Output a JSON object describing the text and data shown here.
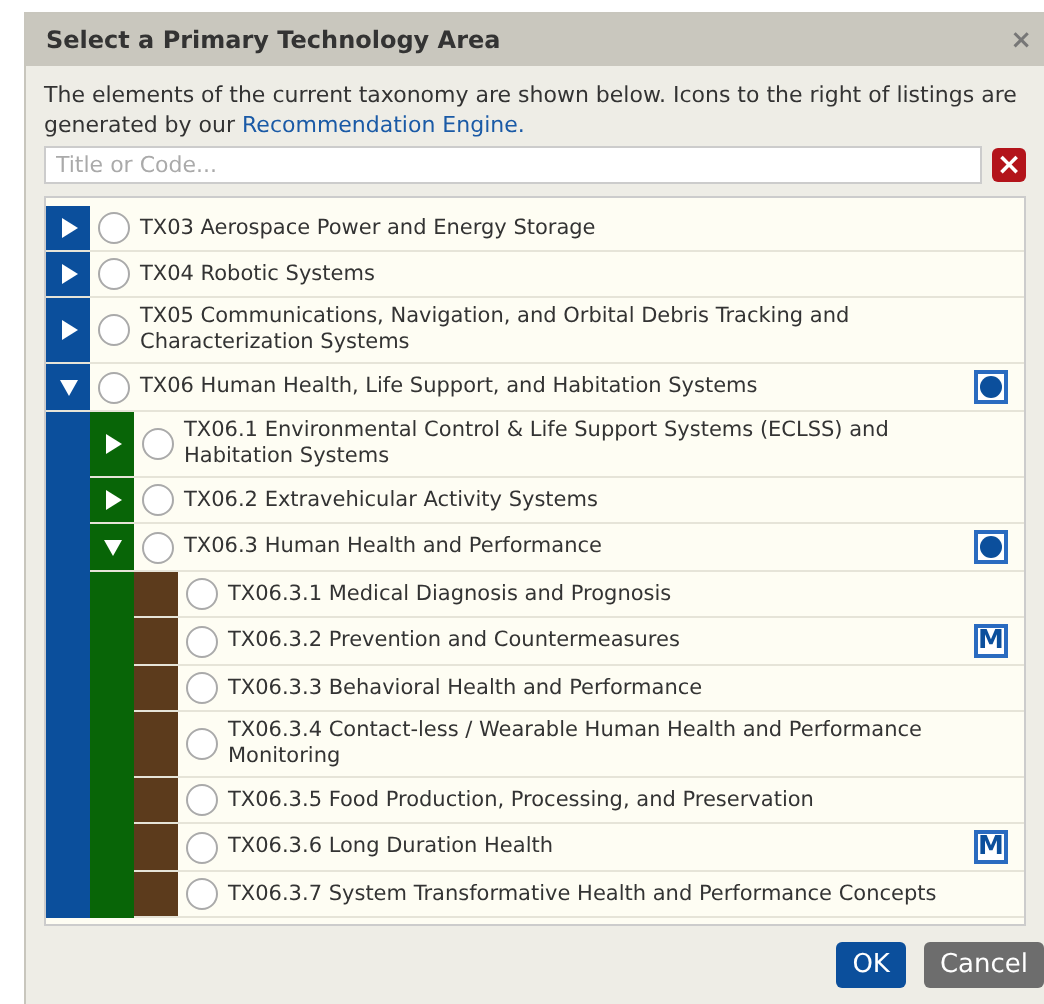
{
  "dialog": {
    "title": "Select a Primary Technology Area",
    "close": "×"
  },
  "intro": {
    "text": "The elements of the current taxonomy are shown below. Icons to the right of listings are generated by our",
    "link": "Recommendation Engine."
  },
  "search": {
    "placeholder": "Title or Code...",
    "clear": "×"
  },
  "tree": [
    {
      "label": "TX03 Aerospace Power and Energy Storage",
      "expanded": false,
      "selected": false
    },
    {
      "label": "TX04 Robotic Systems",
      "expanded": false,
      "selected": false
    },
    {
      "label": "TX05 Communications, Navigation, and Orbital Debris Tracking and Characterization Systems",
      "expanded": false,
      "selected": false
    },
    {
      "label": "TX06 Human Health, Life Support, and Habitation Systems",
      "expanded": true,
      "selected": false,
      "badge": {
        "kind": "dot"
      },
      "children": [
        {
          "label": "TX06.1 Environmental Control & Life Support Systems (ECLSS) and Habitation Systems",
          "expanded": false,
          "selected": false
        },
        {
          "label": "TX06.2 Extravehicular Activity Systems",
          "expanded": false,
          "selected": false
        },
        {
          "label": "TX06.3 Human Health and Performance",
          "expanded": true,
          "selected": false,
          "badge": {
            "kind": "dot"
          },
          "children": [
            {
              "label": "TX06.3.1 Medical Diagnosis and Prognosis",
              "selected": false
            },
            {
              "label": "TX06.3.2 Prevention and Countermeasures",
              "selected": false,
              "badge": {
                "kind": "letter",
                "text": "M"
              }
            },
            {
              "label": "TX06.3.3 Behavioral Health and Performance",
              "selected": false
            },
            {
              "label": "TX06.3.4 Contact-less / Wearable Human Health and Performance Monitoring",
              "selected": false
            },
            {
              "label": "TX06.3.5 Food Production, Processing, and Preservation",
              "selected": false
            },
            {
              "label": "TX06.3.6 Long Duration Health",
              "selected": false,
              "badge": {
                "kind": "letter",
                "text": "M"
              }
            },
            {
              "label": "TX06.3.7 System Transformative Health and Performance Concepts",
              "selected": false
            }
          ]
        }
      ]
    }
  ],
  "buttons": [
    {
      "label": "OK",
      "kind": "primary"
    },
    {
      "label": "Cancel",
      "kind": "secondary"
    }
  ]
}
